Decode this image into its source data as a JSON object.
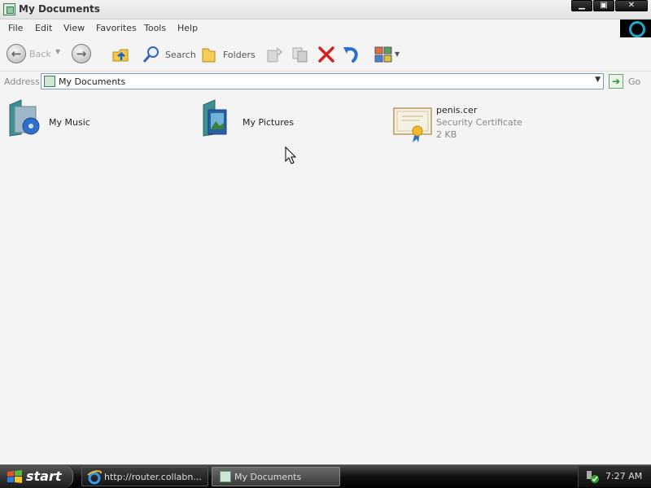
{
  "window": {
    "title": "My Documents"
  },
  "window_controls": {
    "minimize": "▁",
    "maximize": "▣",
    "close": "✕"
  },
  "menu": [
    "File",
    "Edit",
    "View",
    "Favorites",
    "Tools",
    "Help"
  ],
  "toolbar": {
    "back_label": "Back",
    "search_label": "Search",
    "folders_label": "Folders"
  },
  "address": {
    "label": "Address",
    "value": "My Documents",
    "go_label": "Go"
  },
  "items": [
    {
      "name": "My Music",
      "icon": "music-folder-icon"
    },
    {
      "name": "My Pictures",
      "icon": "pictures-folder-icon"
    },
    {
      "name": "penis.cer",
      "type": "Security Certificate",
      "size": "2 KB",
      "icon": "certificate-icon"
    }
  ],
  "taskbar": {
    "start_label": "start",
    "tasks": [
      {
        "label": "http://router.collabn...",
        "icon": "ie-icon"
      },
      {
        "label": "My Documents",
        "icon": "folder-window-icon"
      }
    ],
    "clock": "7:27 AM"
  },
  "colors": {
    "accent": "#1fa8c8",
    "delete_red": "#d42020",
    "undo_blue": "#2a6fd0"
  }
}
